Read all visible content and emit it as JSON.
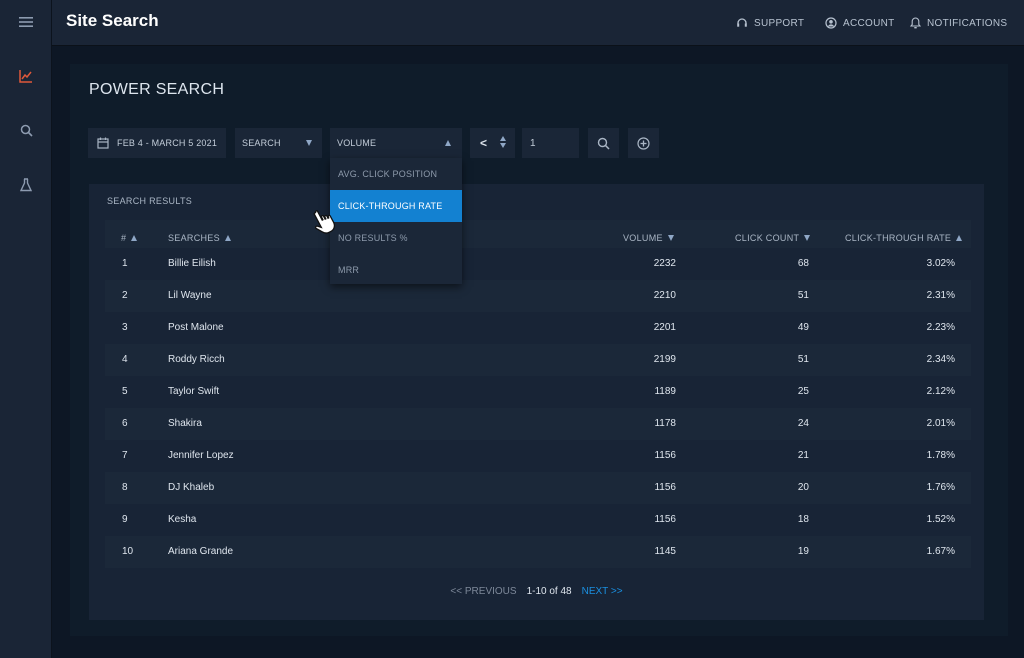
{
  "app": {
    "title": "Site Search",
    "nav": {
      "support": "SUPPORT",
      "account": "ACCOUNT",
      "notifications": "NOTIFICATIONS"
    }
  },
  "rail": {
    "icons": [
      "menu-icon",
      "chart-icon",
      "search-icon",
      "flask-icon"
    ],
    "active": "chart-icon"
  },
  "page": {
    "title": "POWER SEARCH"
  },
  "controls": {
    "date_range": "FEB 4 - MARCH 5 2021",
    "search_field": "SEARCH",
    "metric_select": "VOLUME",
    "operator": "<",
    "value": "1"
  },
  "dropdown": {
    "options": [
      "AVG. CLICK POSITION",
      "CLICK-THROUGH RATE",
      "NO RESULTS %",
      "MRR"
    ],
    "selected": "CLICK-THROUGH RATE"
  },
  "results": {
    "title": "SEARCH RESULTS",
    "columns": {
      "index": "#",
      "searches": "SEARCHES",
      "volume": "VOLUME",
      "click_count": "CLICK COUNT",
      "ctr": "CLICK-THROUGH RATE"
    },
    "rows": [
      {
        "index": "1",
        "search": "Billie Eilish",
        "volume": "2232",
        "clicks": "68",
        "ctr": "3.02%"
      },
      {
        "index": "2",
        "search": "Lil Wayne",
        "volume": "2210",
        "clicks": "51",
        "ctr": "2.31%"
      },
      {
        "index": "3",
        "search": "Post Malone",
        "volume": "2201",
        "clicks": "49",
        "ctr": "2.23%"
      },
      {
        "index": "4",
        "search": "Roddy Ricch",
        "volume": "2199",
        "clicks": "51",
        "ctr": "2.34%"
      },
      {
        "index": "5",
        "search": "Taylor Swift",
        "volume": "1189",
        "clicks": "25",
        "ctr": "2.12%"
      },
      {
        "index": "6",
        "search": "Shakira",
        "volume": "1178",
        "clicks": "24",
        "ctr": "2.01%"
      },
      {
        "index": "7",
        "search": "Jennifer Lopez",
        "volume": "1156",
        "clicks": "21",
        "ctr": "1.78%"
      },
      {
        "index": "8",
        "search": "DJ Khaleb",
        "volume": "1156",
        "clicks": "20",
        "ctr": "1.76%"
      },
      {
        "index": "9",
        "search": "Kesha",
        "volume": "1156",
        "clicks": "18",
        "ctr": "1.52%"
      },
      {
        "index": "10",
        "search": "Ariana Grande",
        "volume": "1145",
        "clicks": "19",
        "ctr": "1.67%"
      }
    ],
    "pagination": {
      "previous": "<< PREVIOUS",
      "range": "1-10 of 48",
      "next": "NEXT >>"
    }
  },
  "colors": {
    "accent": "#1381d1",
    "rail_active": "#e0583a",
    "background": "#0d1725"
  }
}
